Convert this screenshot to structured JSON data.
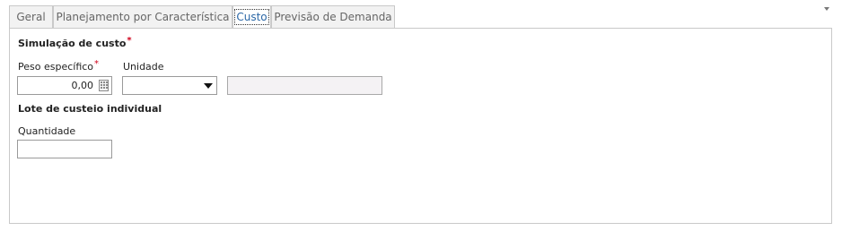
{
  "tabs": [
    {
      "label": "Geral"
    },
    {
      "label": "Planejamento por Característica"
    },
    {
      "label": "Custo"
    },
    {
      "label": "Previsão de Demanda"
    }
  ],
  "active_tab": "Custo",
  "sections": {
    "cost_simulation": {
      "title": "Simulação de custo",
      "required_mark": "*",
      "specific_weight": {
        "label": "Peso específico",
        "required_mark": "*",
        "value": "0,00"
      },
      "unit": {
        "label": "Unidade",
        "selected": ""
      },
      "unit_description": {
        "value": ""
      }
    },
    "individual_costing_lot": {
      "title": "Lote de custeio individual",
      "quantity": {
        "label": "Quantidade",
        "value": ""
      }
    }
  },
  "colors": {
    "accent": "#2b67a6",
    "required": "#d0021b",
    "border": "#c9c9c9"
  }
}
